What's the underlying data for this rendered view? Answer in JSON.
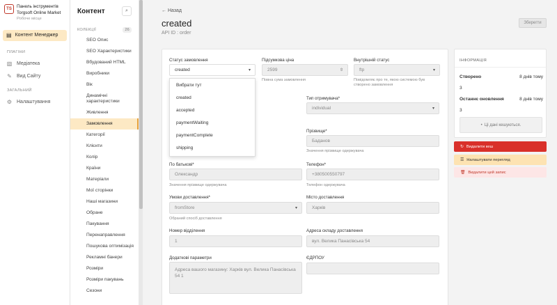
{
  "sidebar": {
    "logo_text": "TS",
    "app_title_1": "Панель інструментів",
    "app_title_2": "Torgsoft Online Market",
    "app_subtitle": "Робоче місце",
    "active_item": "Контент Менеджер",
    "plugins_title": "ПЛАГІНИ",
    "plugins": [
      "Медіатека",
      "Вид Сайту"
    ],
    "general_title": "ЗАГАЛЬНИЙ",
    "general": [
      "Налаштування"
    ]
  },
  "content_panel": {
    "title": "Контент",
    "collections_label": "КОЛЕКЦІЇ",
    "collections_count": "26",
    "items": [
      "SEO Опис",
      "SEO Характеристики",
      "Вбудований HTML",
      "Виробники",
      "Вік",
      "Динамічні характеристики",
      "Живлення",
      "Замовлення",
      "Категорії",
      "Клієнти",
      "Колір",
      "Країни",
      "Матеріали",
      "Мої сторінки",
      "Наші магазини",
      "Обране",
      "Пакування",
      "Перенаправлення",
      "Пошукова оптимізація",
      "Рекламні банери",
      "Розміри",
      "Розміри пакувань",
      "Сезони"
    ],
    "active_index": 7
  },
  "header": {
    "back": "Назад",
    "title": "created",
    "api_id": "API ID : order",
    "save": "Зберегти"
  },
  "form": {
    "status": {
      "label": "Статус замовлення",
      "value": "created"
    },
    "total": {
      "label": "Підсумкова ціна",
      "value": "2599",
      "hint": "Повна сума замовлення"
    },
    "internal_status": {
      "label": "Внутрішній статус",
      "value": "ftp",
      "hint": "Повідомляє про те, якою системою був створено замовлення"
    },
    "receiver_type": {
      "label": "Тип отримувача*",
      "value": "individual"
    },
    "surname": {
      "label": "Прізвище*",
      "value": "Баданов",
      "hint": "Значення прізвище одержувача"
    },
    "patronymic": {
      "label": "По батькові*",
      "value": "Олександр",
      "hint": "Значення прізвище одержувача"
    },
    "phone": {
      "label": "Телефон*",
      "value": "+380500550797",
      "hint": "Телефон одержувача"
    },
    "delivery_method": {
      "label": "Умови доставлення*",
      "value": "fromStore",
      "hint": "Обраний спосіб доставлення"
    },
    "delivery_city": {
      "label": "Місто доставлення",
      "value": "Харків"
    },
    "department": {
      "label": "Номер відділення",
      "value": "1"
    },
    "warehouse": {
      "label": "Адреса складу доставлення",
      "value": "вул. Велика Панасівська 54"
    },
    "extra": {
      "label": "Додаткові параметри",
      "value": "Адреса вашого магазину: Харків вул. Велика Панасівська 54 1"
    },
    "edrpou": {
      "label": "ЄДРПОУ",
      "value": ""
    }
  },
  "dropdown": {
    "options": [
      "Вибрати тут",
      "created",
      "accepted",
      "paymentWaiting",
      "paymentComplete",
      "shipping"
    ]
  },
  "info": {
    "title": "ІНФОРМАЦІЯ",
    "created_label": "Створено",
    "created_value": "8 днів тому",
    "created_by": "3",
    "updated_label": "Останнє оновлення",
    "updated_value": "8 днів тому",
    "updated_by": "3",
    "cache": "Ці дані кешуються."
  },
  "actions": {
    "delete_cache": "Видалити кеш",
    "configure_view": "Налаштувати перегляд",
    "delete_record": "Видалити цей запис"
  }
}
